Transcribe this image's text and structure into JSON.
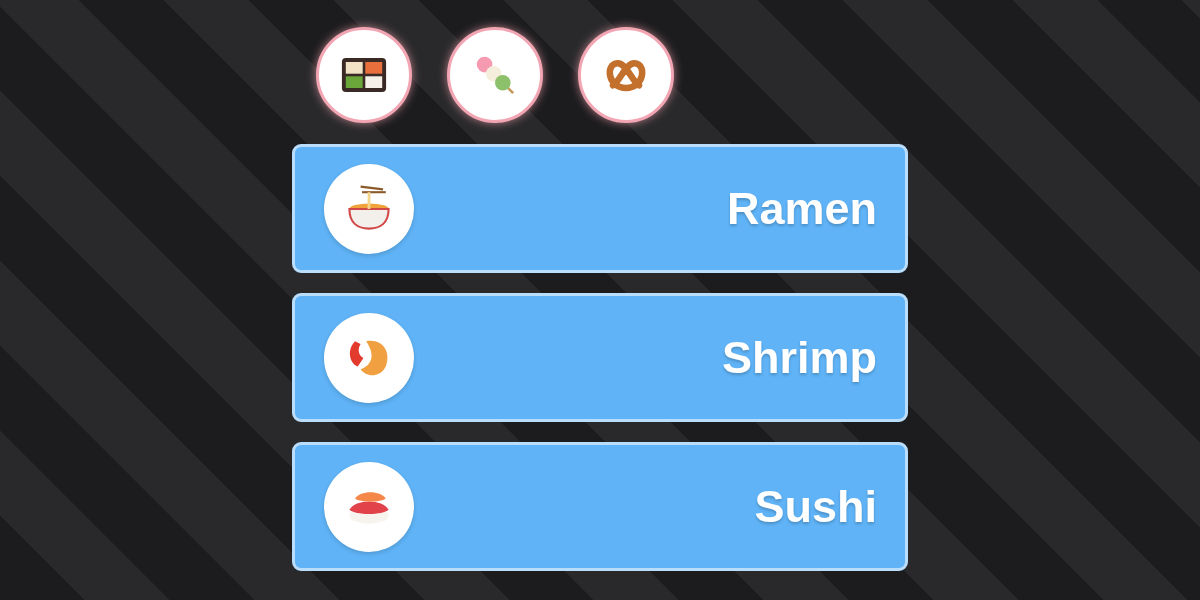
{
  "favorites": [
    {
      "kind": "bento"
    },
    {
      "kind": "dango"
    },
    {
      "kind": "pretzel"
    }
  ],
  "items": [
    {
      "kind": "ramen",
      "label": "Ramen"
    },
    {
      "kind": "shrimp",
      "label": "Shrimp"
    },
    {
      "kind": "sushi",
      "label": "Sushi"
    }
  ]
}
